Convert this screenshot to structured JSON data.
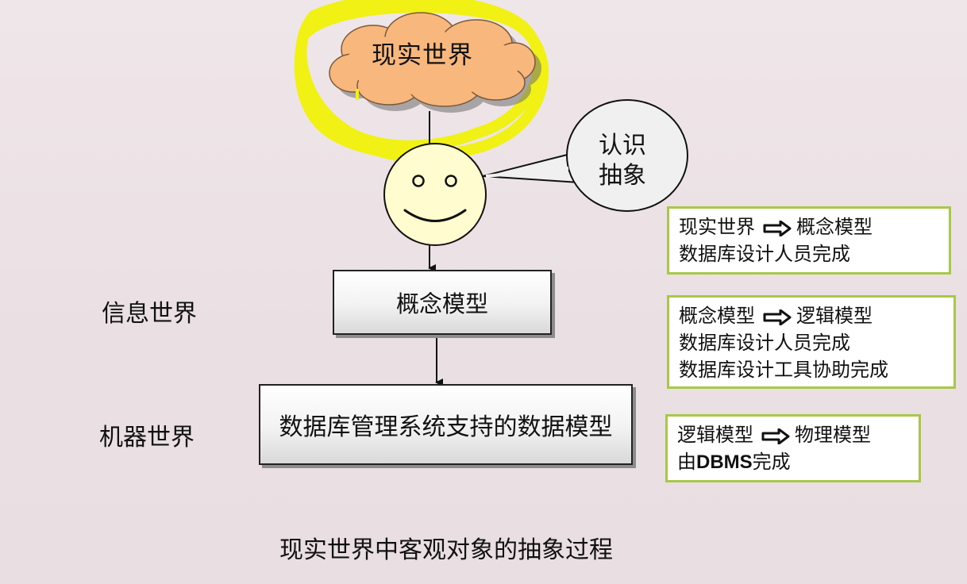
{
  "cloud": {
    "label": "现实世界"
  },
  "speech": {
    "line1": "认识",
    "line2": "抽象"
  },
  "boxes": {
    "concept": "概念模型",
    "dbms": "数据库管理系统支持的数据模型"
  },
  "worlds": {
    "info": "信息世界",
    "machine": "机器世界"
  },
  "notes": [
    {
      "from": "现实世界",
      "to": "概念模型",
      "lines": [
        "数据库设计人员完成"
      ]
    },
    {
      "from": "概念模型",
      "to": "逻辑模型",
      "lines": [
        "数据库设计人员完成",
        "数据库设计工具协助完成"
      ]
    },
    {
      "from": "逻辑模型",
      "to": "物理模型",
      "prefix": "由",
      "bold": "DBMS",
      "suffix": "完成"
    }
  ],
  "caption": "现实世界中客观对象的抽象过程",
  "colors": {
    "highlight": "#f2f20a",
    "cloud_fill": "#f8b77d",
    "note_border": "#a8c84a",
    "face_fill": "#fffcd0"
  }
}
